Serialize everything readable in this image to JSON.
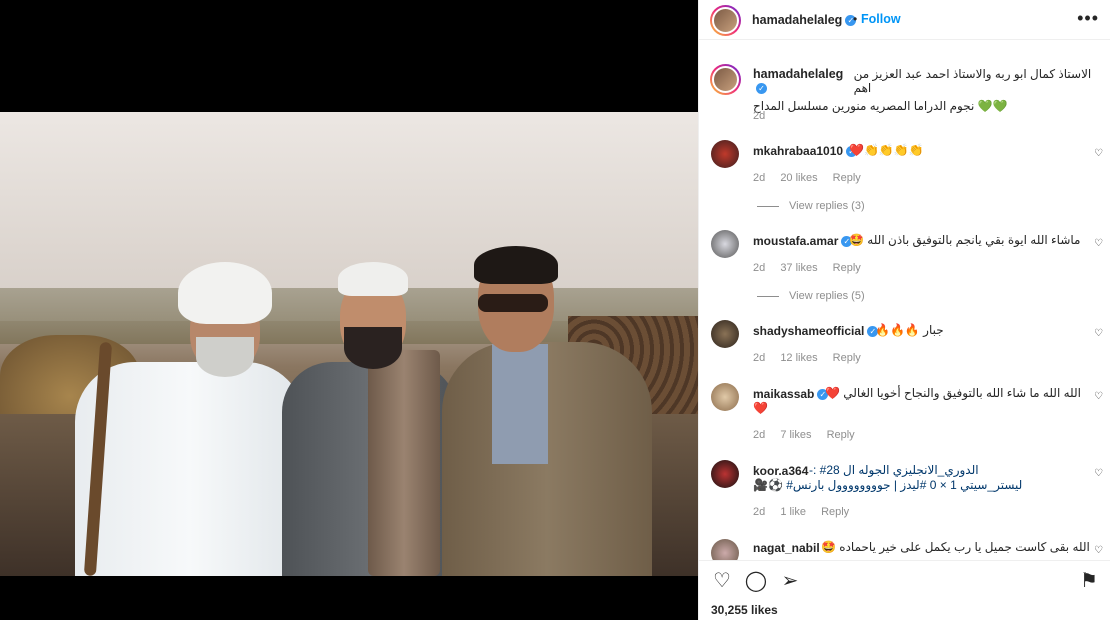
{
  "post": {
    "username": "hamadahelaleg",
    "follow_label": "Follow",
    "separator": "•",
    "more_label": "•••",
    "caption_line1": "الاستاذ كمال ابو ربه والاستاذ احمد عبد العزيز من اهم",
    "caption_line2": "نجوم الدراما المصريه منورين مسلسل المداح 💚💚",
    "caption_time": "2d",
    "likes": "30,255 likes"
  },
  "comments": [
    {
      "user": "mkahrabaa1010",
      "verified": true,
      "text": "👏👏👏👏❤️",
      "time": "2d",
      "likes": "20 likes",
      "reply": "Reply",
      "view_replies": "View replies (3)"
    },
    {
      "user": "moustafa.amar",
      "verified": true,
      "text": "ماشاء الله ايوة بقي يانجم بالتوفيق باذن الله 🤩",
      "time": "2d",
      "likes": "37 likes",
      "reply": "Reply",
      "view_replies": "View replies (5)"
    },
    {
      "user": "shadyshameofficial",
      "verified": true,
      "text": "جبار 🔥🔥🔥",
      "time": "2d",
      "likes": "12 likes",
      "reply": "Reply"
    },
    {
      "user": "maikassab",
      "verified": true,
      "text": "الله الله ما شاء الله بالتوفيق والنجاح أخويا الغالي ❤️",
      "text2": "❤️",
      "time": "2d",
      "likes": "7 likes",
      "reply": "Reply"
    },
    {
      "user": "koor.a364",
      "verified": false,
      "text": "الدوري_الانجليزي الجوله ال 28# :-",
      "text2": "ليستر_سيتي 1 × 0 #ليدز | جوووووووول بارنس# ⚽🎥",
      "time": "2d",
      "likes": "1 like",
      "reply": "Reply"
    },
    {
      "user": "nagat_nabil",
      "verified": false,
      "text": "الله بقى كاست جميل يا رب يكمل على خير ياحماده 🤩"
    }
  ],
  "icons": {
    "heart": "heart-icon",
    "comment": "comment-icon",
    "share": "share-icon",
    "save": "bookmark-icon"
  }
}
